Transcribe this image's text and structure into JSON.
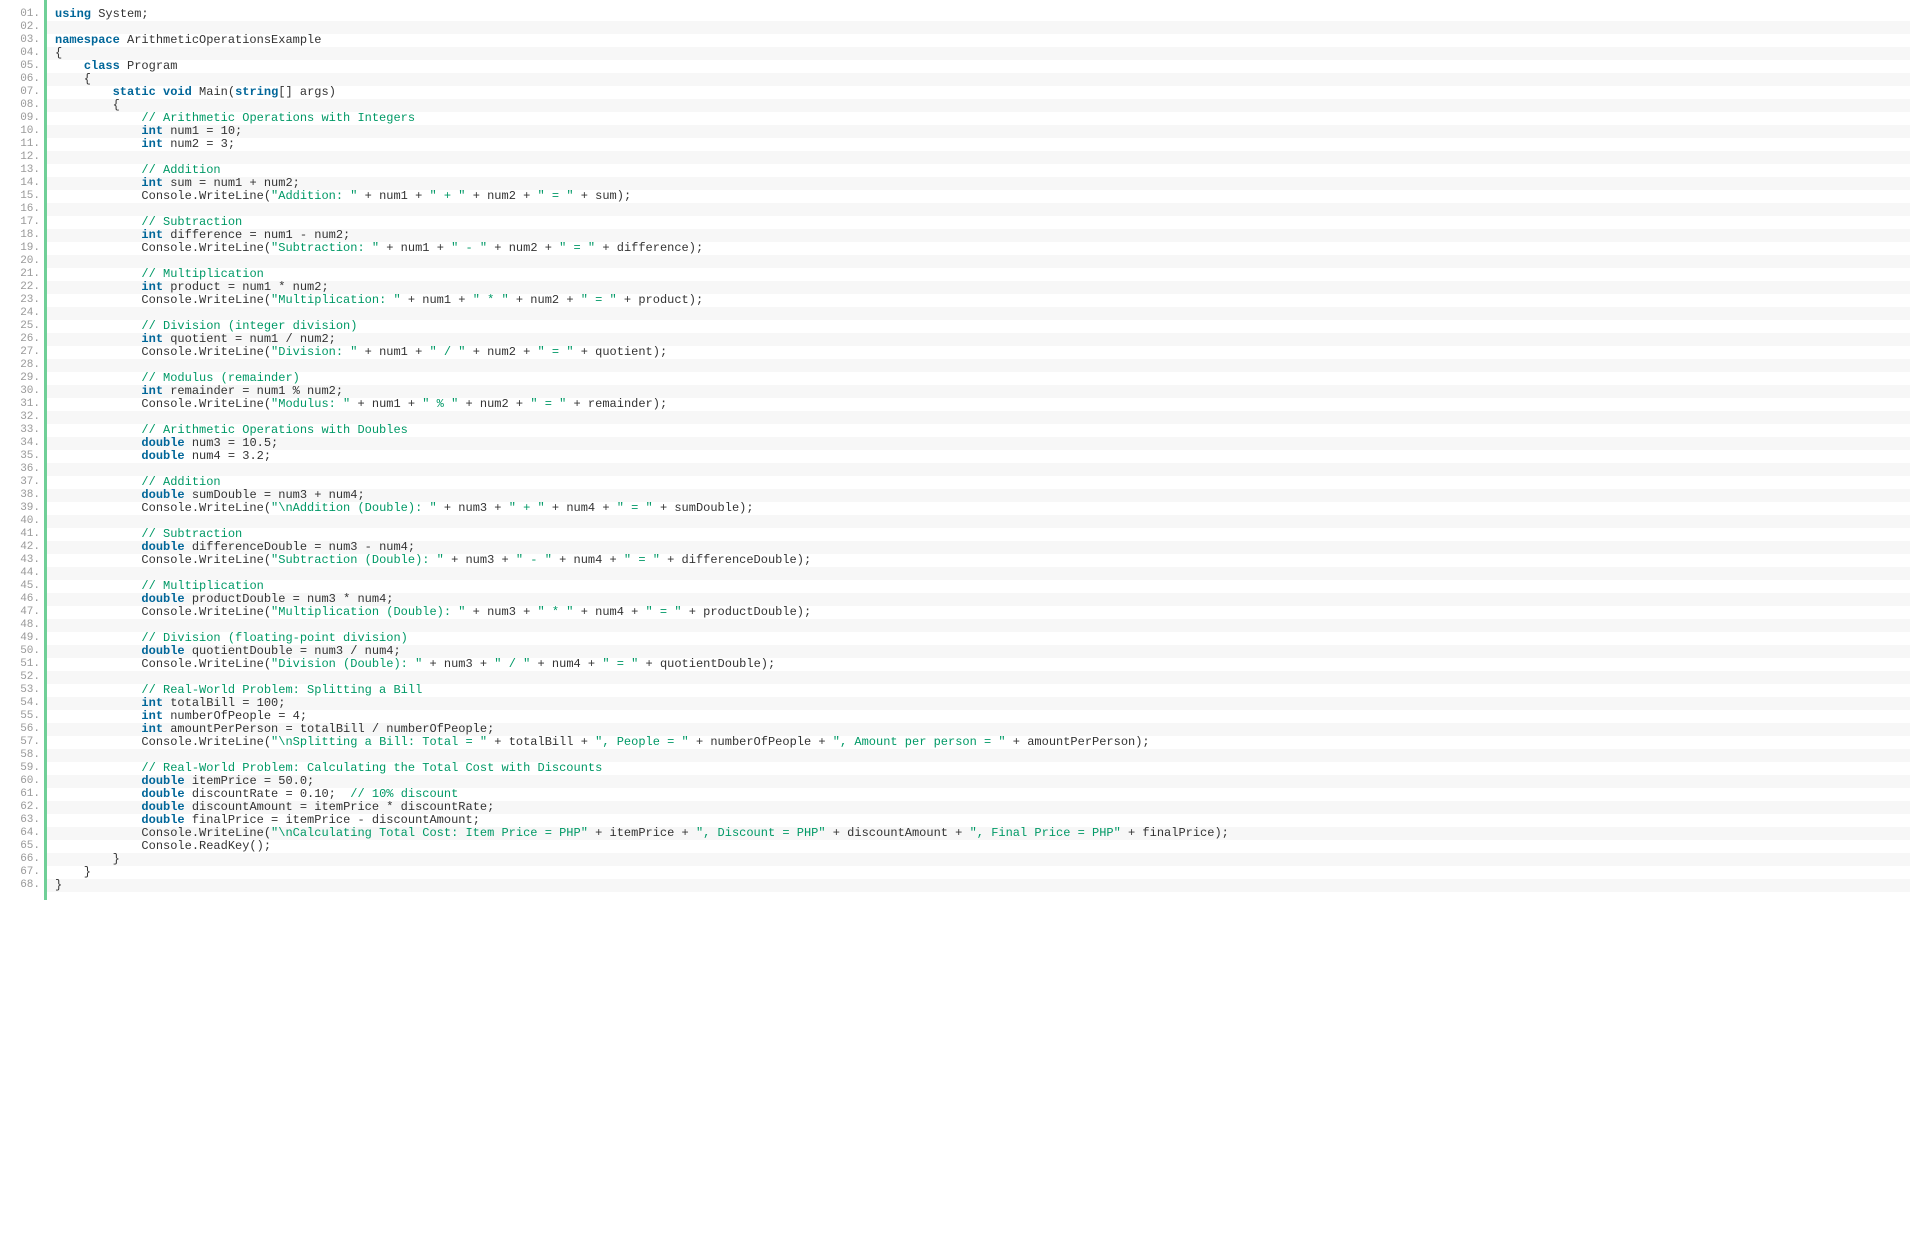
{
  "lineCount": 68,
  "code": [
    [
      [
        "kw",
        "using"
      ],
      [
        "pl",
        " System;"
      ]
    ],
    [],
    [
      [
        "kw",
        "namespace"
      ],
      [
        "pl",
        " ArithmeticOperationsExample"
      ]
    ],
    [
      [
        "pl",
        "{"
      ]
    ],
    [
      [
        "pl",
        "    "
      ],
      [
        "kw",
        "class"
      ],
      [
        "pl",
        " Program"
      ]
    ],
    [
      [
        "pl",
        "    {"
      ]
    ],
    [
      [
        "pl",
        "        "
      ],
      [
        "kw",
        "static"
      ],
      [
        "pl",
        " "
      ],
      [
        "kw",
        "void"
      ],
      [
        "pl",
        " Main("
      ],
      [
        "kw",
        "string"
      ],
      [
        "pl",
        "[] args)"
      ]
    ],
    [
      [
        "pl",
        "        {"
      ]
    ],
    [
      [
        "pl",
        "            "
      ],
      [
        "cm",
        "// Arithmetic Operations with Integers"
      ]
    ],
    [
      [
        "pl",
        "            "
      ],
      [
        "kw",
        "int"
      ],
      [
        "pl",
        " num1 = 10;"
      ]
    ],
    [
      [
        "pl",
        "            "
      ],
      [
        "kw",
        "int"
      ],
      [
        "pl",
        " num2 = 3;"
      ]
    ],
    [],
    [
      [
        "pl",
        "            "
      ],
      [
        "cm",
        "// Addition"
      ]
    ],
    [
      [
        "pl",
        "            "
      ],
      [
        "kw",
        "int"
      ],
      [
        "pl",
        " sum = num1 + num2;"
      ]
    ],
    [
      [
        "pl",
        "            Console.WriteLine("
      ],
      [
        "str",
        "\"Addition: \""
      ],
      [
        "pl",
        " + num1 + "
      ],
      [
        "str",
        "\" + \""
      ],
      [
        "pl",
        " + num2 + "
      ],
      [
        "str",
        "\" = \""
      ],
      [
        "pl",
        " + sum);"
      ]
    ],
    [],
    [
      [
        "pl",
        "            "
      ],
      [
        "cm",
        "// Subtraction"
      ]
    ],
    [
      [
        "pl",
        "            "
      ],
      [
        "kw",
        "int"
      ],
      [
        "pl",
        " difference = num1 - num2;"
      ]
    ],
    [
      [
        "pl",
        "            Console.WriteLine("
      ],
      [
        "str",
        "\"Subtraction: \""
      ],
      [
        "pl",
        " + num1 + "
      ],
      [
        "str",
        "\" - \""
      ],
      [
        "pl",
        " + num2 + "
      ],
      [
        "str",
        "\" = \""
      ],
      [
        "pl",
        " + difference);"
      ]
    ],
    [],
    [
      [
        "pl",
        "            "
      ],
      [
        "cm",
        "// Multiplication"
      ]
    ],
    [
      [
        "pl",
        "            "
      ],
      [
        "kw",
        "int"
      ],
      [
        "pl",
        " product = num1 * num2;"
      ]
    ],
    [
      [
        "pl",
        "            Console.WriteLine("
      ],
      [
        "str",
        "\"Multiplication: \""
      ],
      [
        "pl",
        " + num1 + "
      ],
      [
        "str",
        "\" * \""
      ],
      [
        "pl",
        " + num2 + "
      ],
      [
        "str",
        "\" = \""
      ],
      [
        "pl",
        " + product);"
      ]
    ],
    [],
    [
      [
        "pl",
        "            "
      ],
      [
        "cm",
        "// Division (integer division)"
      ]
    ],
    [
      [
        "pl",
        "            "
      ],
      [
        "kw",
        "int"
      ],
      [
        "pl",
        " quotient = num1 / num2;"
      ]
    ],
    [
      [
        "pl",
        "            Console.WriteLine("
      ],
      [
        "str",
        "\"Division: \""
      ],
      [
        "pl",
        " + num1 + "
      ],
      [
        "str",
        "\" / \""
      ],
      [
        "pl",
        " + num2 + "
      ],
      [
        "str",
        "\" = \""
      ],
      [
        "pl",
        " + quotient);"
      ]
    ],
    [],
    [
      [
        "pl",
        "            "
      ],
      [
        "cm",
        "// Modulus (remainder)"
      ]
    ],
    [
      [
        "pl",
        "            "
      ],
      [
        "kw",
        "int"
      ],
      [
        "pl",
        " remainder = num1 % num2;"
      ]
    ],
    [
      [
        "pl",
        "            Console.WriteLine("
      ],
      [
        "str",
        "\"Modulus: \""
      ],
      [
        "pl",
        " + num1 + "
      ],
      [
        "str",
        "\" % \""
      ],
      [
        "pl",
        " + num2 + "
      ],
      [
        "str",
        "\" = \""
      ],
      [
        "pl",
        " + remainder);"
      ]
    ],
    [],
    [
      [
        "pl",
        "            "
      ],
      [
        "cm",
        "// Arithmetic Operations with Doubles"
      ]
    ],
    [
      [
        "pl",
        "            "
      ],
      [
        "kw",
        "double"
      ],
      [
        "pl",
        " num3 = 10.5;"
      ]
    ],
    [
      [
        "pl",
        "            "
      ],
      [
        "kw",
        "double"
      ],
      [
        "pl",
        " num4 = 3.2;"
      ]
    ],
    [],
    [
      [
        "pl",
        "            "
      ],
      [
        "cm",
        "// Addition"
      ]
    ],
    [
      [
        "pl",
        "            "
      ],
      [
        "kw",
        "double"
      ],
      [
        "pl",
        " sumDouble = num3 + num4;"
      ]
    ],
    [
      [
        "pl",
        "            Console.WriteLine("
      ],
      [
        "str",
        "\"\\nAddition (Double): \""
      ],
      [
        "pl",
        " + num3 + "
      ],
      [
        "str",
        "\" + \""
      ],
      [
        "pl",
        " + num4 + "
      ],
      [
        "str",
        "\" = \""
      ],
      [
        "pl",
        " + sumDouble);"
      ]
    ],
    [],
    [
      [
        "pl",
        "            "
      ],
      [
        "cm",
        "// Subtraction"
      ]
    ],
    [
      [
        "pl",
        "            "
      ],
      [
        "kw",
        "double"
      ],
      [
        "pl",
        " differenceDouble = num3 - num4;"
      ]
    ],
    [
      [
        "pl",
        "            Console.WriteLine("
      ],
      [
        "str",
        "\"Subtraction (Double): \""
      ],
      [
        "pl",
        " + num3 + "
      ],
      [
        "str",
        "\" - \""
      ],
      [
        "pl",
        " + num4 + "
      ],
      [
        "str",
        "\" = \""
      ],
      [
        "pl",
        " + differenceDouble);"
      ]
    ],
    [],
    [
      [
        "pl",
        "            "
      ],
      [
        "cm",
        "// Multiplication"
      ]
    ],
    [
      [
        "pl",
        "            "
      ],
      [
        "kw",
        "double"
      ],
      [
        "pl",
        " productDouble = num3 * num4;"
      ]
    ],
    [
      [
        "pl",
        "            Console.WriteLine("
      ],
      [
        "str",
        "\"Multiplication (Double): \""
      ],
      [
        "pl",
        " + num3 + "
      ],
      [
        "str",
        "\" * \""
      ],
      [
        "pl",
        " + num4 + "
      ],
      [
        "str",
        "\" = \""
      ],
      [
        "pl",
        " + productDouble);"
      ]
    ],
    [],
    [
      [
        "pl",
        "            "
      ],
      [
        "cm",
        "// Division (floating-point division)"
      ]
    ],
    [
      [
        "pl",
        "            "
      ],
      [
        "kw",
        "double"
      ],
      [
        "pl",
        " quotientDouble = num3 / num4;"
      ]
    ],
    [
      [
        "pl",
        "            Console.WriteLine("
      ],
      [
        "str",
        "\"Division (Double): \""
      ],
      [
        "pl",
        " + num3 + "
      ],
      [
        "str",
        "\" / \""
      ],
      [
        "pl",
        " + num4 + "
      ],
      [
        "str",
        "\" = \""
      ],
      [
        "pl",
        " + quotientDouble);"
      ]
    ],
    [],
    [
      [
        "pl",
        "            "
      ],
      [
        "cm",
        "// Real-World Problem: Splitting a Bill"
      ]
    ],
    [
      [
        "pl",
        "            "
      ],
      [
        "kw",
        "int"
      ],
      [
        "pl",
        " totalBill = 100;"
      ]
    ],
    [
      [
        "pl",
        "            "
      ],
      [
        "kw",
        "int"
      ],
      [
        "pl",
        " numberOfPeople = 4;"
      ]
    ],
    [
      [
        "pl",
        "            "
      ],
      [
        "kw",
        "int"
      ],
      [
        "pl",
        " amountPerPerson = totalBill / numberOfPeople;"
      ]
    ],
    [
      [
        "pl",
        "            Console.WriteLine("
      ],
      [
        "str",
        "\"\\nSplitting a Bill: Total = \""
      ],
      [
        "pl",
        " + totalBill + "
      ],
      [
        "str",
        "\", People = \""
      ],
      [
        "pl",
        " + numberOfPeople + "
      ],
      [
        "str",
        "\", Amount per person = \""
      ],
      [
        "pl",
        " + amountPerPerson);"
      ]
    ],
    [],
    [
      [
        "pl",
        "            "
      ],
      [
        "cm",
        "// Real-World Problem: Calculating the Total Cost with Discounts"
      ]
    ],
    [
      [
        "pl",
        "            "
      ],
      [
        "kw",
        "double"
      ],
      [
        "pl",
        " itemPrice = 50.0;"
      ]
    ],
    [
      [
        "pl",
        "            "
      ],
      [
        "kw",
        "double"
      ],
      [
        "pl",
        " discountRate = 0.10;  "
      ],
      [
        "cm",
        "// 10% discount"
      ]
    ],
    [
      [
        "pl",
        "            "
      ],
      [
        "kw",
        "double"
      ],
      [
        "pl",
        " discountAmount = itemPrice * discountRate;"
      ]
    ],
    [
      [
        "pl",
        "            "
      ],
      [
        "kw",
        "double"
      ],
      [
        "pl",
        " finalPrice = itemPrice - discountAmount;"
      ]
    ],
    [
      [
        "pl",
        "            Console.WriteLine("
      ],
      [
        "str",
        "\"\\nCalculating Total Cost: Item Price = PHP\""
      ],
      [
        "pl",
        " + itemPrice + "
      ],
      [
        "str",
        "\", Discount = PHP\""
      ],
      [
        "pl",
        " + discountAmount + "
      ],
      [
        "str",
        "\", Final Price = PHP\""
      ],
      [
        "pl",
        " + finalPrice);"
      ]
    ],
    [
      [
        "pl",
        "            Console.ReadKey();"
      ]
    ],
    [
      [
        "pl",
        "        }"
      ]
    ],
    [
      [
        "pl",
        "    }"
      ]
    ],
    [
      [
        "pl",
        "}"
      ]
    ]
  ]
}
